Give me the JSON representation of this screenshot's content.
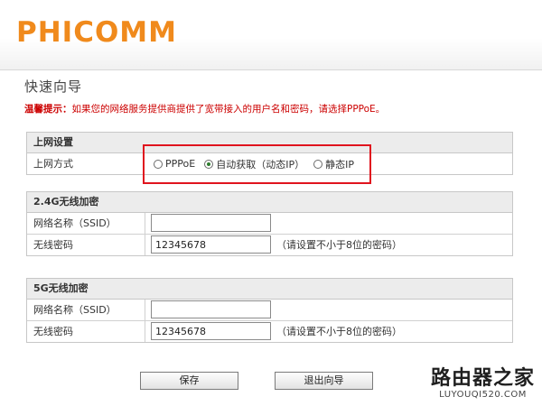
{
  "header": {
    "logo": "PHICOMM"
  },
  "page": {
    "title": "快速向导",
    "tip_label": "温馨提示：",
    "tip_text": "如果您的网络服务提供商提供了宽带接入的用户名和密码，请选择PPPoE。"
  },
  "internet": {
    "heading": "上网设置",
    "mode_label": "上网方式",
    "options": [
      "PPPoE",
      "自动获取（动态IP）",
      "静态IP"
    ],
    "selected": "自动获取（动态IP）"
  },
  "wifi24": {
    "heading": "2.4G无线加密",
    "ssid_label": "网络名称（SSID）",
    "ssid_value": "",
    "password_label": "无线密码",
    "password_value": "12345678",
    "password_hint": "（请设置不小于8位的密码）"
  },
  "wifi5": {
    "heading": "5G无线加密",
    "ssid_label": "网络名称（SSID）",
    "ssid_value": "",
    "password_label": "无线密码",
    "password_value": "12345678",
    "password_hint": "（请设置不小于8位的密码）"
  },
  "buttons": {
    "save": "保存",
    "exit": "退出向导"
  },
  "watermark": {
    "cn": "路由器之家",
    "url": "LUYOUQI520.COM"
  },
  "colors": {
    "logo": "#f08a1c",
    "tip": "#cc0000",
    "highlight": "#e0141e",
    "radio_selected": "#2f7d2f"
  }
}
